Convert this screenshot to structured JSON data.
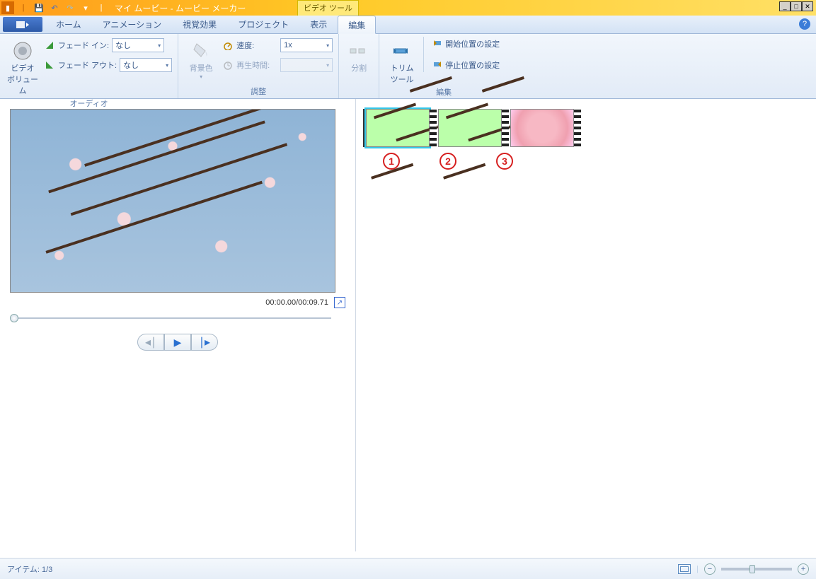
{
  "window": {
    "title": "マイ ムービー - ムービー メーカー",
    "context_tab": "ビデオ ツール"
  },
  "tabs": {
    "home": "ホーム",
    "animation": "アニメーション",
    "visual": "視覚効果",
    "project": "プロジェクト",
    "view": "表示",
    "edit": "編集"
  },
  "ribbon": {
    "audio": {
      "volume_label": "ビデオ\nボリューム",
      "fade_in_label": "フェード イン:",
      "fade_out_label": "フェード アウト:",
      "fade_in_value": "なし",
      "fade_out_value": "なし",
      "group_label": "オーディオ"
    },
    "adjust": {
      "bgcolor_label": "背景色",
      "speed_label": "速度:",
      "speed_value": "1x",
      "duration_label": "再生時間:",
      "duration_value": "",
      "group_label": "調整"
    },
    "split": {
      "label": "分割"
    },
    "trim": {
      "label": "トリム\nツール"
    },
    "edit": {
      "start_label": "開始位置の設定",
      "end_label": "停止位置の設定",
      "group_label": "編集"
    }
  },
  "preview": {
    "time": "00:00.00/00:09.71"
  },
  "annotations": {
    "a1": "1",
    "a2": "2",
    "a3": "3"
  },
  "status": {
    "items": "アイテム: 1/3"
  }
}
